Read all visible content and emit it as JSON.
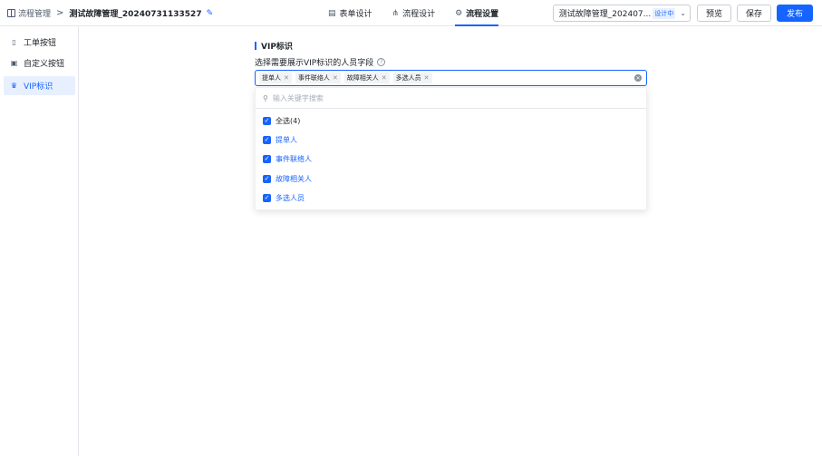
{
  "header": {
    "breadcrumb_root": "流程管理",
    "separator": ">",
    "title": "测试故障管理_20240731133527",
    "tabs": [
      {
        "label": "表单设计",
        "icon": "form-icon"
      },
      {
        "label": "流程设计",
        "icon": "flow-icon"
      },
      {
        "label": "流程设置",
        "icon": "settings-icon"
      }
    ],
    "active_tab": "流程设置",
    "version_label": "测试故障管理_202407...",
    "version_badge": "设计中",
    "preview_label": "预览",
    "save_label": "保存",
    "publish_label": "发布"
  },
  "sidebar": {
    "items": [
      {
        "label": "工单按钮",
        "icon": "document-icon"
      },
      {
        "label": "自定义按钮",
        "icon": "custom-button-icon"
      },
      {
        "label": "VIP标识",
        "icon": "crown-icon"
      }
    ],
    "active": "VIP标识"
  },
  "main": {
    "section_title": "VIP标识",
    "field_label": "选择需要展示VIP标识的人员字段",
    "selected_chips": [
      "提单人",
      "事件联络人",
      "故障相关人",
      "多选人员"
    ],
    "dropdown": {
      "search_placeholder": "输入关键字搜索",
      "select_all_label": "全选(4)",
      "options": [
        {
          "label": "提单人",
          "checked": true
        },
        {
          "label": "事件联络人",
          "checked": true
        },
        {
          "label": "故障相关人",
          "checked": true
        },
        {
          "label": "多选人员",
          "checked": true
        }
      ]
    }
  },
  "colors": {
    "accent": "#1664ff",
    "accent_bg": "#e8f0ff",
    "border": "#e5e6eb"
  }
}
